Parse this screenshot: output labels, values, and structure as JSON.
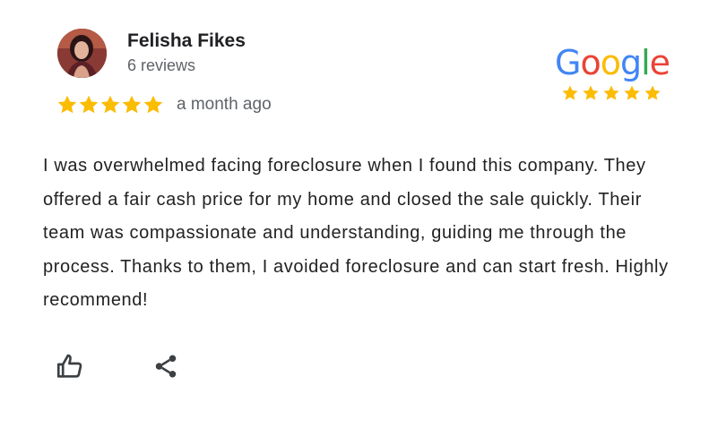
{
  "reviewer": {
    "name": "Felisha Fikes",
    "reviews_count": "6 reviews"
  },
  "rating": {
    "stars": 5,
    "max_stars": 5,
    "age": "a month ago",
    "star_color": "#fbbc04"
  },
  "google_badge": {
    "letters": [
      {
        "char": "G",
        "color": "#4285f4"
      },
      {
        "char": "o",
        "color": "#ea4335"
      },
      {
        "char": "o",
        "color": "#fbbc04"
      },
      {
        "char": "g",
        "color": "#4285f4"
      },
      {
        "char": "l",
        "color": "#34a853"
      },
      {
        "char": "e",
        "color": "#ea4335"
      }
    ],
    "stars": 5
  },
  "review": {
    "text": "I was overwhelmed facing foreclosure when I found this company. They offered a fair cash price for my home and closed the sale quickly. Their team was compassionate and understanding, guiding me through the process. Thanks to them, I avoided foreclosure and can start fresh. Highly recommend!"
  },
  "actions": {
    "like_icon": "thumbs-up-icon",
    "share_icon": "share-icon"
  }
}
